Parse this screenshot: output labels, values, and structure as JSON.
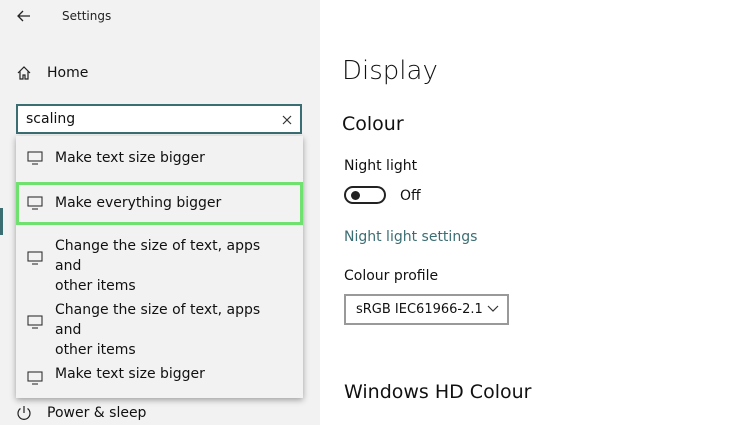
{
  "window": {
    "title": "Settings"
  },
  "sidebar": {
    "home_label": "Home",
    "search": {
      "value": "scaling",
      "placeholder": ""
    },
    "results": [
      {
        "line1": "Make text size bigger",
        "line2": ""
      },
      {
        "line1": "Make everything bigger",
        "line2": ""
      },
      {
        "line1": "Change the size of text, apps and",
        "line2": "other items"
      },
      {
        "line1": "Change the size of text, apps and",
        "line2": "other items"
      },
      {
        "line1": "Make text size bigger",
        "line2": ""
      }
    ],
    "power_label": "Power & sleep"
  },
  "main": {
    "title": "Display",
    "colour_heading": "Colour",
    "night_light_label": "Night light",
    "night_light_state": "Off",
    "night_light_settings_link": "Night light settings",
    "colour_profile_label": "Colour profile",
    "colour_profile_value": "sRGB IEC61966-2.1",
    "hd_colour_heading": "Windows HD Colour"
  },
  "colors": {
    "accent": "#3b6e73",
    "highlight": "#6ee16e",
    "sidebar_bg": "#f2f2f2"
  }
}
